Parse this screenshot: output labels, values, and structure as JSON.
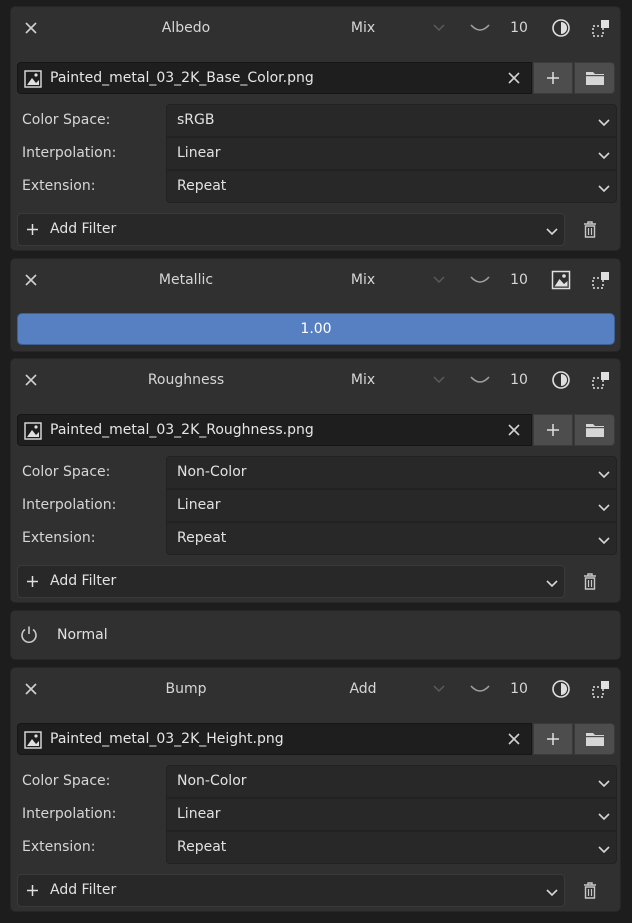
{
  "channels": [
    {
      "name": "Albedo",
      "blend": "Mix",
      "value": "10",
      "mode_icon": "circle-half-icon",
      "image": "Painted_metal_03_2K_Base_Color.png",
      "color_space_label": "Color Space:",
      "color_space": "sRGB",
      "interpolation_label": "Interpolation:",
      "interpolation": "Linear",
      "extension_label": "Extension:",
      "extension": "Repeat",
      "add_filter": "Add Filter"
    },
    {
      "name": "Metallic",
      "blend": "Mix",
      "value": "10",
      "mode_icon": "image-icon",
      "slider_value": "1.00"
    },
    {
      "name": "Roughness",
      "blend": "Mix",
      "value": "10",
      "mode_icon": "circle-half-icon",
      "image": "Painted_metal_03_2K_Roughness.png",
      "color_space_label": "Color Space:",
      "color_space": "Non-Color",
      "interpolation_label": "Interpolation:",
      "interpolation": "Linear",
      "extension_label": "Extension:",
      "extension": "Repeat",
      "add_filter": "Add Filter"
    },
    {
      "name": "Normal"
    },
    {
      "name": "Bump",
      "blend": "Add",
      "value": "10",
      "mode_icon": "circle-half-icon",
      "image": "Painted_metal_03_2K_Height.png",
      "color_space_label": "Color Space:",
      "color_space": "Non-Color",
      "interpolation_label": "Interpolation:",
      "interpolation": "Linear",
      "extension_label": "Extension:",
      "extension": "Repeat",
      "add_filter": "Add Filter"
    }
  ],
  "colors": {
    "accent": "#5680c2",
    "panel": "#303030",
    "background": "#1d1d1d"
  }
}
